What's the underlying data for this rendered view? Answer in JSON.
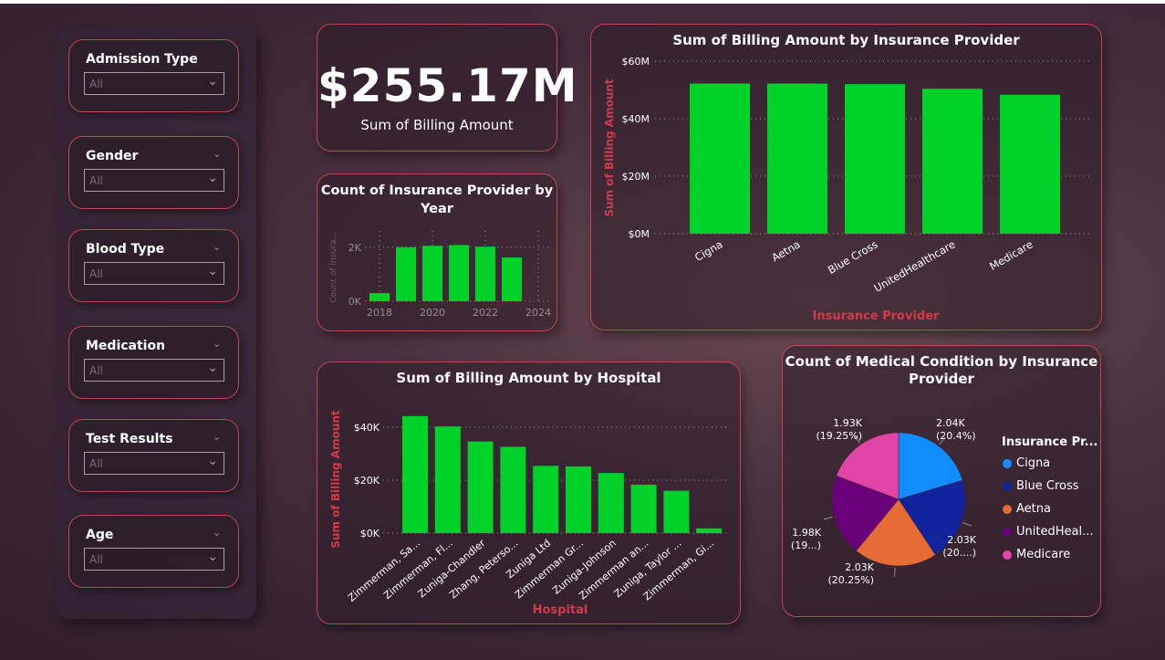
{
  "slicers": [
    {
      "label": "Admission Type",
      "value": "All",
      "show_chevron": false
    },
    {
      "label": "Gender",
      "value": "All",
      "show_chevron": true
    },
    {
      "label": "Blood Type",
      "value": "All",
      "show_chevron": true
    },
    {
      "label": "Medication",
      "value": "All",
      "show_chevron": true
    },
    {
      "label": "Test Results",
      "value": "All",
      "show_chevron": true
    },
    {
      "label": "Age",
      "value": "All",
      "show_chevron": true
    }
  ],
  "kpi": {
    "value": "$255.17M",
    "label": "Sum of Billing Amount"
  },
  "colors": {
    "bar": "#00d22a",
    "axis_title": "#d23a4a",
    "card_border": "#c0484f"
  },
  "chart_data": [
    {
      "id": "year",
      "type": "bar",
      "title": "Count of Insurance Provider by Year",
      "title_lines": [
        "Count of Insurance Provider by",
        "Year"
      ],
      "ylabel": "Count of Insura...",
      "x": [
        2018,
        2019,
        2020,
        2021,
        2022,
        2023
      ],
      "values": [
        300,
        2000,
        2050,
        2080,
        2020,
        1620
      ],
      "xticks": [
        "2018",
        "2020",
        "2022",
        "2024"
      ],
      "yticks": [
        "0K",
        "2K"
      ],
      "ylim": [
        0,
        2500
      ]
    },
    {
      "id": "insurance",
      "type": "bar",
      "title": "Sum of Billing Amount by Insurance Provider",
      "xlabel": "Insurance Provider",
      "ylabel": "Sum of Billing Amount",
      "categories": [
        "Cigna",
        "Aetna",
        "Blue Cross",
        "UnitedHealthcare",
        "Medicare"
      ],
      "values": [
        52.2,
        52.2,
        52.0,
        50.4,
        48.3
      ],
      "yticks": [
        "$0M",
        "$20M",
        "$40M",
        "$60M"
      ],
      "ylim": [
        0,
        60
      ],
      "unit": "M"
    },
    {
      "id": "hospital",
      "type": "bar",
      "title": "Sum of Billing Amount by Hospital",
      "xlabel": "Hospital",
      "ylabel": "Sum of Billing Amount",
      "categories": [
        "Zimmerman, Sa...",
        "Zimmerman, Fl...",
        "Zuniga-Chandler",
        "Zhang, Peterso...",
        "Zuniga Ltd",
        "Zimmerman Gr...",
        "Zuniga-Johnson",
        "Zimmerman an...",
        "Zuniga, Taylor ...",
        "Zimmerman, Gi..."
      ],
      "values": [
        44.2,
        40.3,
        34.6,
        32.6,
        25.4,
        25.2,
        22.7,
        18.3,
        16.0,
        1.8
      ],
      "yticks": [
        "$0K",
        "$20K",
        "$40K"
      ],
      "ylim": [
        0,
        50
      ],
      "unit": "K"
    },
    {
      "id": "pie",
      "type": "pie",
      "title": "Count of Medical Condition by Insurance Provider",
      "title_lines": [
        "Count of Medical Condition by Insurance",
        "Provider"
      ],
      "legend_title": "Insurance Pr...",
      "slices": [
        {
          "name": "Cigna",
          "value": 20.4,
          "label1": "2.04K",
          "label2": "(20.4%)",
          "color": "#118dff"
        },
        {
          "name": "Blue Cross",
          "value": 20.3,
          "label1": "2.03K",
          "label2": "(20....)",
          "color": "#12239e"
        },
        {
          "name": "Aetna",
          "value": 20.25,
          "label1": "2.03K",
          "label2": "(20.25%)",
          "color": "#e66c37"
        },
        {
          "name": "UnitedHeal...",
          "value": 19.8,
          "label1": "1.98K",
          "label2": "(19...)",
          "color": "#6b007b"
        },
        {
          "name": "Medicare",
          "value": 19.25,
          "label1": "1.93K",
          "label2": "(19.25%)",
          "color": "#e044a7"
        }
      ]
    }
  ]
}
